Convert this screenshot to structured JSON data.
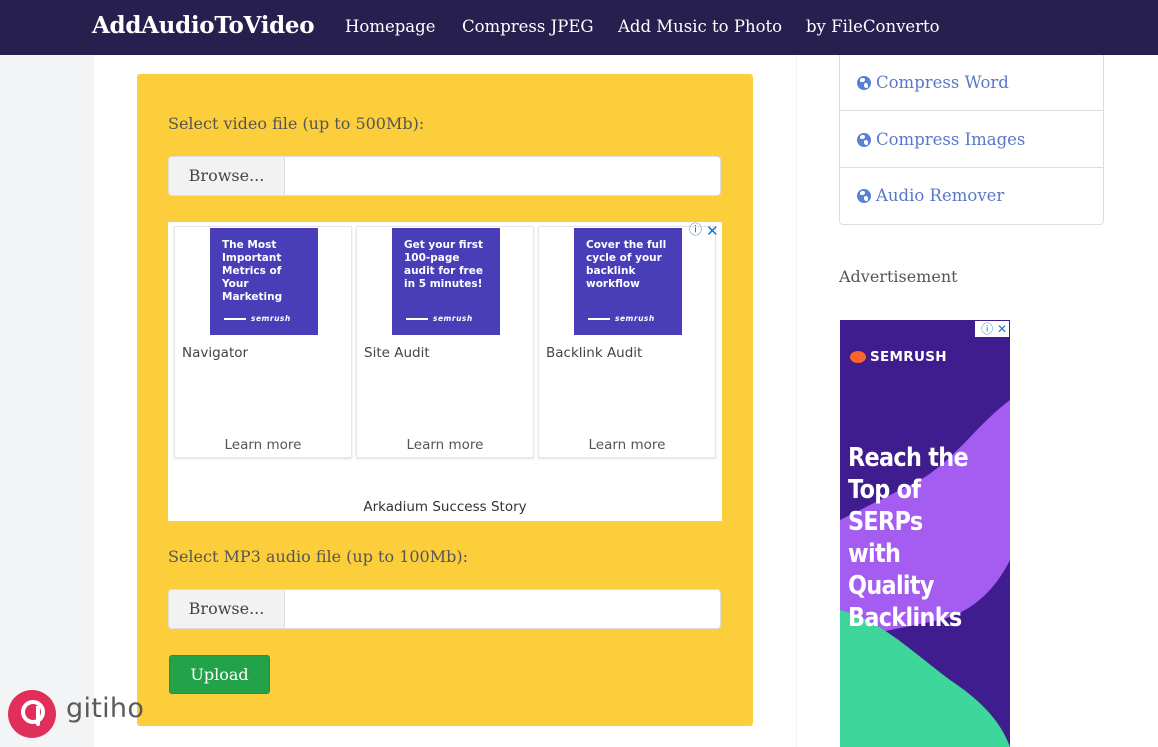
{
  "header": {
    "brand": "AddAudioToVideo",
    "nav": [
      "Homepage",
      "Compress JPEG",
      "Add Music to Photo",
      "by FileConverto"
    ]
  },
  "form": {
    "video_label": "Select video file (up to 500Mb):",
    "audio_label": "Select MP3 audio file (up to 100Mb):",
    "browse_label": "Browse...",
    "upload_label": "Upload"
  },
  "inline_ad": {
    "cards": [
      {
        "image_text": "The Most Important Metrics of Your Marketing",
        "brand": "semrush",
        "title": "Navigator",
        "cta": "Learn more"
      },
      {
        "image_text": "Get your first 100-page audit for free in 5 minutes!",
        "brand": "semrush",
        "title": "Site Audit",
        "cta": "Learn more"
      },
      {
        "image_text": "Cover the full cycle of your backlink workflow",
        "brand": "semrush",
        "title": "Backlink Audit",
        "cta": "Learn more"
      }
    ],
    "footer": "Arkadium Success Story",
    "adchoices_icons": [
      "info-icon",
      "close-icon"
    ]
  },
  "sidebar": {
    "items": [
      "Compress Word",
      "Compress Images",
      "Audio Remover"
    ],
    "icon": "globe-icon",
    "advertisement_label": "Advertisement"
  },
  "sky_ad": {
    "brand": "SEMRUSH",
    "headline": "Reach the Top of SERPs with Quality Backlinks"
  },
  "watermark": {
    "text": "gitiho"
  },
  "colors": {
    "navbar": "#27204e",
    "panel": "#fdce3b",
    "upload": "#22a34a",
    "link": "#5a78c8",
    "ad_purple": "#4a3db8"
  }
}
